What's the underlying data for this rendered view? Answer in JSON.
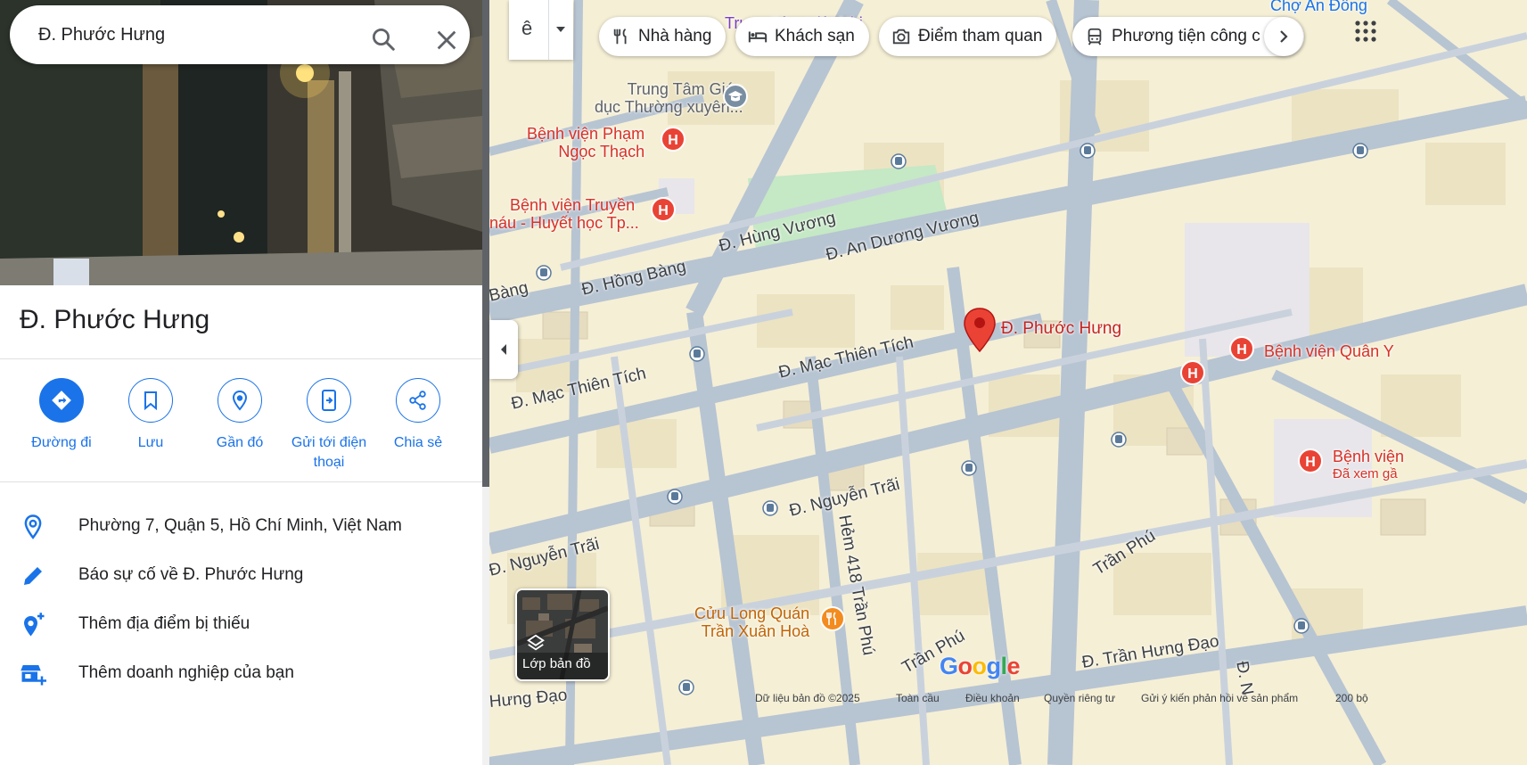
{
  "search": {
    "value": "Đ. Phước Hưng"
  },
  "place": {
    "title": "Đ. Phước Hưng"
  },
  "actions": [
    {
      "label": "Đường đi"
    },
    {
      "label": "Lưu"
    },
    {
      "label": "Gần đó"
    },
    {
      "label": "Gửi tới điện thoại"
    },
    {
      "label": "Chia sẻ"
    }
  ],
  "info": [
    {
      "text": "Phường 7, Quận 5, Hồ Chí Minh, Việt Nam"
    },
    {
      "text": "Báo sự cố về Đ. Phước Hưng"
    },
    {
      "text": "Thêm địa điểm bị thiếu"
    },
    {
      "text": "Thêm doanh nghiệp của bạn"
    }
  ],
  "input_tool": {
    "label": "ê"
  },
  "chips": [
    {
      "label": "Nhà hàng",
      "icon": "restaurant-icon"
    },
    {
      "label": "Khách sạn",
      "icon": "hotel-icon"
    },
    {
      "label": "Điểm tham quan",
      "icon": "camera-icon"
    },
    {
      "label": "Phương tiện công c",
      "icon": "transit-icon"
    }
  ],
  "map": {
    "pin_label": "Đ. Phước Hưng",
    "streets": [
      "Đ. Hùng Vương",
      "Đ. An Dương Vương",
      "Đ. Hồng Bàng",
      "Bàng",
      "Đ. Mạc Thiên Tích",
      "Đ. Mạc Thiên Tích",
      "Đ. Nguyễn Trãi",
      "Đ. Nguyễn Trãi",
      "Hẻm 418 Trần Phú",
      "Trần Phú",
      "Trần Phú",
      "Đ. Trần Hưng Đạo",
      "Hưng Đạo",
      "Đ. N"
    ],
    "pois": {
      "school": "Trung Tâm Giáo dục Thường xuyên...",
      "school_l1": "Trung Tâm Giáo",
      "school_l2": "dục Thường xuyên...",
      "hospital1_l1": "Bệnh viện Phạm",
      "hospital1_l2": "Ngọc Thạch",
      "hospital2_l1": "Bệnh viện Truyền",
      "hospital2_l2": "náu - Huyết học Tp...",
      "hospital3": "Bệnh viện Quân Y",
      "hospital4_l1": "Bệnh viện",
      "hospital4_l2": "Đã xem gầ",
      "restaurant_l1": "Cửu Long Quán",
      "restaurant_l2": "Trần Xuân Hoà",
      "market": "Chợ An Đông",
      "top_partial": "Trung Tâm Việt Nhi"
    },
    "layer_label": "Lớp bản đồ",
    "google_logo": "Google",
    "footer": [
      "Dữ liệu bản đồ ©2025",
      "Toàn cầu",
      "Điều khoản",
      "Quyền riêng tư",
      "Gửi ý kiến phản hồi về sản phẩm",
      "200 bộ"
    ]
  },
  "colors": {
    "accent": "#1a73e8",
    "pin": "#ea4335",
    "hospital": "#e94335",
    "map_land": "#f5efd6",
    "road": "#aab9c9",
    "park": "#c5e8c5"
  }
}
